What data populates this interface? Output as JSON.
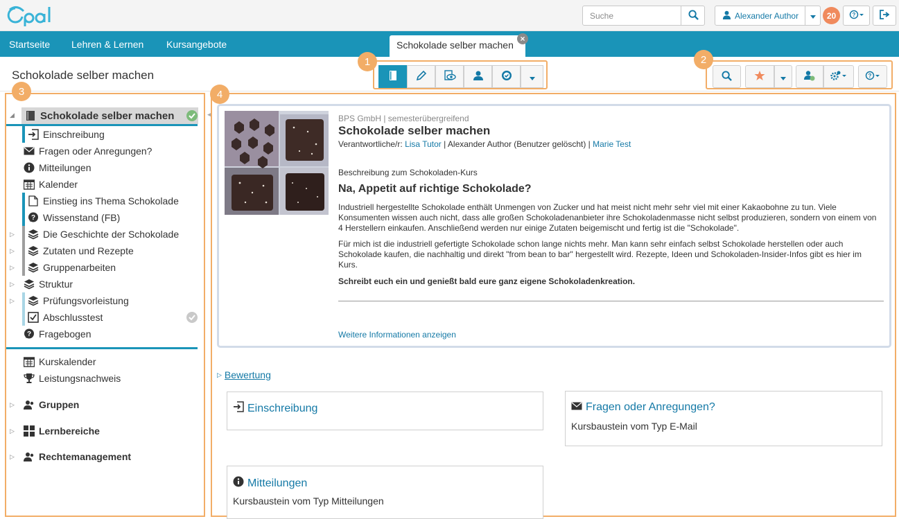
{
  "header": {
    "logo_text": "Opal",
    "search": {
      "placeholder": "Suche",
      "value": ""
    },
    "user_name": "Alexander Author",
    "notification_count": "20"
  },
  "nav": {
    "links": [
      "Startseite",
      "Lehren & Lernen",
      "Kursangebote"
    ],
    "active_tab": "Schokolade selber machen"
  },
  "course": {
    "title": "Schokolade selber machen",
    "callouts": [
      "1",
      "2",
      "3",
      "4"
    ]
  },
  "tree": {
    "root": "Schokolade selber machen",
    "items": [
      "Einschreibung",
      "Fragen oder Anregungen?",
      "Mitteilungen",
      "Kalender",
      "Einstieg ins Thema Schokolade",
      "Wissenstand (FB)",
      "Die Geschichte der Schokolade",
      "Zutaten und Rezepte",
      "Gruppenarbeiten",
      "Struktur",
      "Prüfungsvorleistung",
      "Abschlusstest",
      "Fragebogen"
    ],
    "extras": [
      "Kurskalender",
      "Leistungsnachweis"
    ],
    "sections": [
      "Gruppen",
      "Lernbereiche",
      "Rechtemanagement"
    ]
  },
  "info": {
    "org": "BPS GmbH | semesterübergreifend",
    "title": "Schokolade selber machen",
    "responsible_label": "Verantwortliche/r:",
    "responsible_1": "Lisa Tutor",
    "responsible_middle": "| Alexander Author (Benutzer gelöscht) |",
    "responsible_2": "Marie Test",
    "desc_label": "Beschreibung zum Schokoladen-Kurs",
    "headline": "Na, Appetit auf richtige Schokolade?",
    "para1": "Industriell hergestellte Schokolade enthält Unmengen von Zucker und hat meist nicht mehr sehr viel mit einer Kakaobohne zu tun. Viele Konsumenten wissen auch nicht, dass alle großen Schokoladenanbieter ihre Schokoladenmasse nicht selbst produzieren, sondern von einem von 4 Herstellern einkaufen. Anschließend werden nur einige Zutaten beigemischt und fertig ist die \"Schokolade\".",
    "para2": "Für mich ist die industriell gefertigte Schokolade schon lange nichts mehr. Man kann sehr einfach selbst Schokolade herstellen oder auch Schokolade kaufen, die nachhaltig und direkt \"from bean to bar\" hergestellt wird. Rezepte, Ideen und Schokoladen-Insider-Infos gibt es hier im Kurs.",
    "para3": "Schreibt euch ein und genießt bald eure ganz eigene Schokoladenkreation.",
    "more_link": "Weitere Informationen anzeigen"
  },
  "rating_link": "Bewertung",
  "cards": [
    {
      "title": "Einschreibung",
      "subtitle": ""
    },
    {
      "title": "Fragen oder Anregungen?",
      "subtitle": "Kursbaustein vom Typ E-Mail"
    },
    {
      "title": "Mitteilungen",
      "subtitle": "Kursbaustein vom Typ Mitteilungen"
    }
  ],
  "colors": {
    "brand": "#1a94b8",
    "accent": "#f2ad67",
    "link": "#1479a6",
    "badge": "#f08a5d",
    "done": "#7dbb7a"
  }
}
